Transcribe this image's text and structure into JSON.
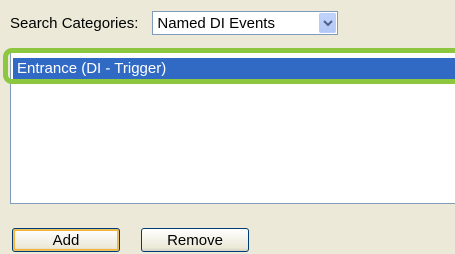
{
  "search": {
    "label": "Search Categories:",
    "selected": "Named DI Events"
  },
  "list": {
    "items": [
      {
        "label": "Entrance (DI - Trigger)",
        "selected": true
      }
    ]
  },
  "buttons": {
    "add": "Add",
    "remove": "Remove"
  },
  "colors": {
    "background": "#ece9d8",
    "selection": "#316ac5",
    "highlight_ring": "#8dc63f",
    "field_border": "#7f9db9"
  },
  "icons": {
    "dropdown": "chevron-down-icon"
  }
}
